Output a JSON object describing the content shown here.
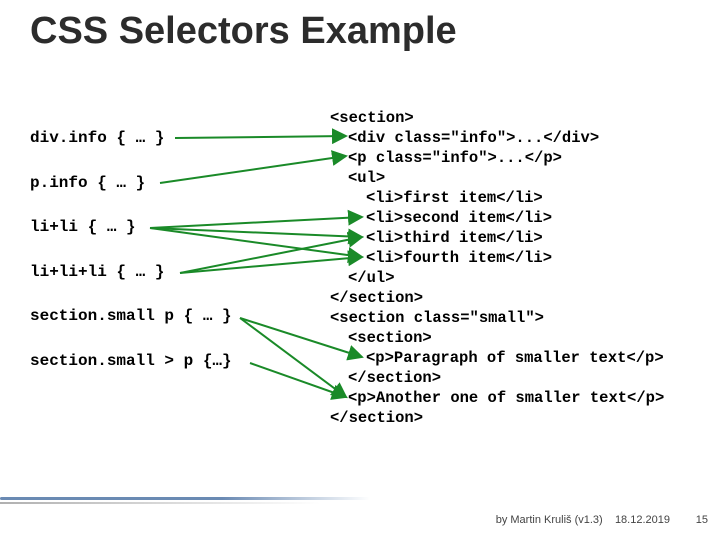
{
  "title": "CSS Selectors Example",
  "selectors": {
    "s1": "div.info { … }",
    "s2": "p.info { … }",
    "s3": "li+li { … }",
    "s4": "li+li+li { … }",
    "s5": "section.small p { … }",
    "s6": "section.small > p {…}"
  },
  "code": {
    "l1": "<section>",
    "l2": "<div class=\"info\">...</div>",
    "l3": "<p class=\"info\">...</p>",
    "l4": "<ul>",
    "l5": "<li>first item</li>",
    "l6": "<li>second item</li>",
    "l7": "<li>third item</li>",
    "l8": "<li>fourth item</li>",
    "l9": "</ul>",
    "l10": "</section>",
    "l11": "<section class=\"small\">",
    "l12": "<section>",
    "l13": "<p>Paragraph of smaller text</p>",
    "l14": "</section>",
    "l15": "<p>Another one of smaller text</p>",
    "l16": "</section>"
  },
  "footer": {
    "credit": "by Martin Kruliš (v1.3)",
    "date": "18.12.2019",
    "page": "15"
  }
}
